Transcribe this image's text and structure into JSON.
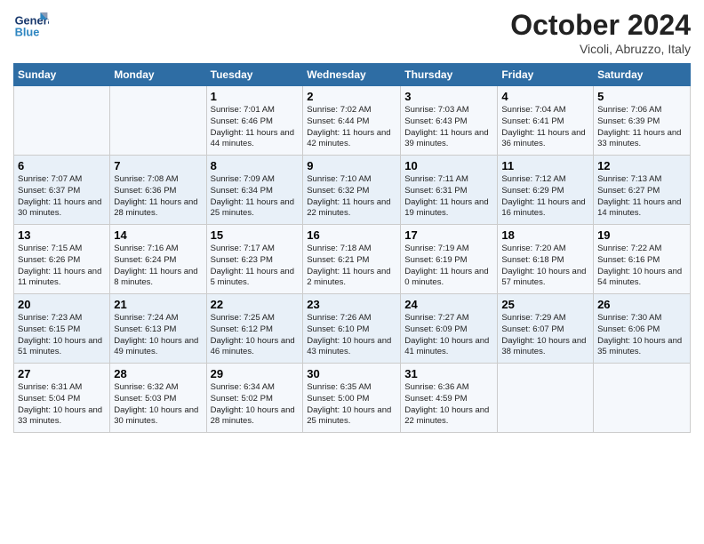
{
  "header": {
    "logo_general": "General",
    "logo_blue": "Blue",
    "month_title": "October 2024",
    "location": "Vicoli, Abruzzo, Italy"
  },
  "days_of_week": [
    "Sunday",
    "Monday",
    "Tuesday",
    "Wednesday",
    "Thursday",
    "Friday",
    "Saturday"
  ],
  "weeks": [
    [
      {
        "day": "",
        "details": ""
      },
      {
        "day": "",
        "details": ""
      },
      {
        "day": "1",
        "details": "Sunrise: 7:01 AM\nSunset: 6:46 PM\nDaylight: 11 hours and 44 minutes."
      },
      {
        "day": "2",
        "details": "Sunrise: 7:02 AM\nSunset: 6:44 PM\nDaylight: 11 hours and 42 minutes."
      },
      {
        "day": "3",
        "details": "Sunrise: 7:03 AM\nSunset: 6:43 PM\nDaylight: 11 hours and 39 minutes."
      },
      {
        "day": "4",
        "details": "Sunrise: 7:04 AM\nSunset: 6:41 PM\nDaylight: 11 hours and 36 minutes."
      },
      {
        "day": "5",
        "details": "Sunrise: 7:06 AM\nSunset: 6:39 PM\nDaylight: 11 hours and 33 minutes."
      }
    ],
    [
      {
        "day": "6",
        "details": "Sunrise: 7:07 AM\nSunset: 6:37 PM\nDaylight: 11 hours and 30 minutes."
      },
      {
        "day": "7",
        "details": "Sunrise: 7:08 AM\nSunset: 6:36 PM\nDaylight: 11 hours and 28 minutes."
      },
      {
        "day": "8",
        "details": "Sunrise: 7:09 AM\nSunset: 6:34 PM\nDaylight: 11 hours and 25 minutes."
      },
      {
        "day": "9",
        "details": "Sunrise: 7:10 AM\nSunset: 6:32 PM\nDaylight: 11 hours and 22 minutes."
      },
      {
        "day": "10",
        "details": "Sunrise: 7:11 AM\nSunset: 6:31 PM\nDaylight: 11 hours and 19 minutes."
      },
      {
        "day": "11",
        "details": "Sunrise: 7:12 AM\nSunset: 6:29 PM\nDaylight: 11 hours and 16 minutes."
      },
      {
        "day": "12",
        "details": "Sunrise: 7:13 AM\nSunset: 6:27 PM\nDaylight: 11 hours and 14 minutes."
      }
    ],
    [
      {
        "day": "13",
        "details": "Sunrise: 7:15 AM\nSunset: 6:26 PM\nDaylight: 11 hours and 11 minutes."
      },
      {
        "day": "14",
        "details": "Sunrise: 7:16 AM\nSunset: 6:24 PM\nDaylight: 11 hours and 8 minutes."
      },
      {
        "day": "15",
        "details": "Sunrise: 7:17 AM\nSunset: 6:23 PM\nDaylight: 11 hours and 5 minutes."
      },
      {
        "day": "16",
        "details": "Sunrise: 7:18 AM\nSunset: 6:21 PM\nDaylight: 11 hours and 2 minutes."
      },
      {
        "day": "17",
        "details": "Sunrise: 7:19 AM\nSunset: 6:19 PM\nDaylight: 11 hours and 0 minutes."
      },
      {
        "day": "18",
        "details": "Sunrise: 7:20 AM\nSunset: 6:18 PM\nDaylight: 10 hours and 57 minutes."
      },
      {
        "day": "19",
        "details": "Sunrise: 7:22 AM\nSunset: 6:16 PM\nDaylight: 10 hours and 54 minutes."
      }
    ],
    [
      {
        "day": "20",
        "details": "Sunrise: 7:23 AM\nSunset: 6:15 PM\nDaylight: 10 hours and 51 minutes."
      },
      {
        "day": "21",
        "details": "Sunrise: 7:24 AM\nSunset: 6:13 PM\nDaylight: 10 hours and 49 minutes."
      },
      {
        "day": "22",
        "details": "Sunrise: 7:25 AM\nSunset: 6:12 PM\nDaylight: 10 hours and 46 minutes."
      },
      {
        "day": "23",
        "details": "Sunrise: 7:26 AM\nSunset: 6:10 PM\nDaylight: 10 hours and 43 minutes."
      },
      {
        "day": "24",
        "details": "Sunrise: 7:27 AM\nSunset: 6:09 PM\nDaylight: 10 hours and 41 minutes."
      },
      {
        "day": "25",
        "details": "Sunrise: 7:29 AM\nSunset: 6:07 PM\nDaylight: 10 hours and 38 minutes."
      },
      {
        "day": "26",
        "details": "Sunrise: 7:30 AM\nSunset: 6:06 PM\nDaylight: 10 hours and 35 minutes."
      }
    ],
    [
      {
        "day": "27",
        "details": "Sunrise: 6:31 AM\nSunset: 5:04 PM\nDaylight: 10 hours and 33 minutes."
      },
      {
        "day": "28",
        "details": "Sunrise: 6:32 AM\nSunset: 5:03 PM\nDaylight: 10 hours and 30 minutes."
      },
      {
        "day": "29",
        "details": "Sunrise: 6:34 AM\nSunset: 5:02 PM\nDaylight: 10 hours and 28 minutes."
      },
      {
        "day": "30",
        "details": "Sunrise: 6:35 AM\nSunset: 5:00 PM\nDaylight: 10 hours and 25 minutes."
      },
      {
        "day": "31",
        "details": "Sunrise: 6:36 AM\nSunset: 4:59 PM\nDaylight: 10 hours and 22 minutes."
      },
      {
        "day": "",
        "details": ""
      },
      {
        "day": "",
        "details": ""
      }
    ]
  ]
}
